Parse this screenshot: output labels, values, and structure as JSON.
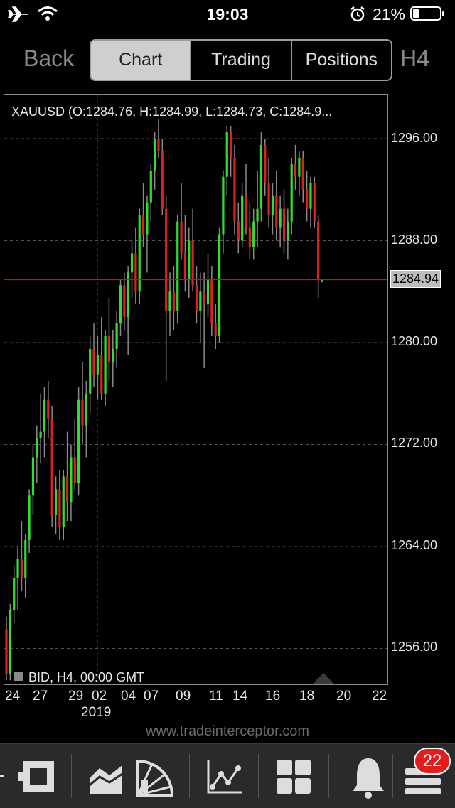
{
  "status": {
    "time": "19:03",
    "battery": "21%"
  },
  "nav": {
    "back": "Back",
    "tabs": [
      "Chart",
      "Trading",
      "Positions"
    ],
    "timeframe": "H4"
  },
  "chart": {
    "ohlc_text": "XAUUSD (O:1284.76, H:1284.99, L:1284.73, C:1284.9...",
    "bid_text": "BID, H4, 00:00 GMT",
    "current_price": "1284.94",
    "y_ticks": [
      "1296.00",
      "1288.00",
      "1280.00",
      "1272.00",
      "1264.00",
      "1256.00"
    ],
    "x_ticks": [
      "24",
      "27",
      "29",
      "02",
      "04",
      "07",
      "09",
      "11",
      "14",
      "16",
      "18",
      "20",
      "22"
    ],
    "year": "2019",
    "colors": {
      "up": "#2de02d",
      "down": "#e02020",
      "wick": "#8a8a8a",
      "price_line": "#cc1111"
    }
  },
  "chart_data": {
    "type": "candlestick",
    "symbol": "XAUUSD",
    "timeframe": "H4",
    "ylim": [
      1252,
      1298
    ],
    "current": 1284.94,
    "ohlc": [
      [
        1257.5,
        1258.5,
        1253.5,
        1254.0
      ],
      [
        1254.0,
        1259.5,
        1253.5,
        1259.0
      ],
      [
        1259.0,
        1262.5,
        1258.0,
        1261.5
      ],
      [
        1261.5,
        1264.0,
        1259.0,
        1263.0
      ],
      [
        1263.0,
        1266.0,
        1260.5,
        1261.5
      ],
      [
        1261.5,
        1265.0,
        1260.0,
        1264.5
      ],
      [
        1264.5,
        1268.5,
        1263.5,
        1268.0
      ],
      [
        1268.0,
        1272.0,
        1266.5,
        1271.0
      ],
      [
        1271.0,
        1273.5,
        1269.0,
        1272.5
      ],
      [
        1272.5,
        1276.0,
        1270.5,
        1273.0
      ],
      [
        1273.0,
        1276.5,
        1271.0,
        1275.5
      ],
      [
        1275.5,
        1277.0,
        1272.5,
        1274.0
      ],
      [
        1274.0,
        1275.0,
        1265.5,
        1266.5
      ],
      [
        1266.5,
        1269.5,
        1265.0,
        1268.5
      ],
      [
        1268.5,
        1270.0,
        1264.5,
        1265.5
      ],
      [
        1265.5,
        1270.0,
        1264.5,
        1269.5
      ],
      [
        1269.5,
        1273.0,
        1266.0,
        1267.5
      ],
      [
        1267.5,
        1272.0,
        1266.0,
        1271.0
      ],
      [
        1271.0,
        1274.0,
        1268.5,
        1269.0
      ],
      [
        1269.0,
        1276.5,
        1268.0,
        1275.5
      ],
      [
        1275.5,
        1278.5,
        1272.0,
        1273.5
      ],
      [
        1273.5,
        1277.0,
        1271.0,
        1276.0
      ],
      [
        1276.0,
        1280.5,
        1274.5,
        1279.5
      ],
      [
        1279.5,
        1281.5,
        1276.5,
        1277.5
      ],
      [
        1277.5,
        1280.5,
        1275.5,
        1279.0
      ],
      [
        1279.0,
        1282.0,
        1275.5,
        1276.0
      ],
      [
        1276.0,
        1281.0,
        1275.0,
        1280.5
      ],
      [
        1280.5,
        1283.5,
        1277.0,
        1278.5
      ],
      [
        1278.5,
        1281.0,
        1276.5,
        1279.5
      ],
      [
        1279.5,
        1282.5,
        1278.0,
        1281.5
      ],
      [
        1281.5,
        1285.0,
        1280.5,
        1284.5
      ],
      [
        1284.5,
        1285.5,
        1281.0,
        1282.0
      ],
      [
        1282.0,
        1286.0,
        1279.0,
        1285.5
      ],
      [
        1285.5,
        1288.0,
        1283.5,
        1287.0
      ],
      [
        1287.0,
        1289.0,
        1283.0,
        1284.0
      ],
      [
        1284.0,
        1290.5,
        1283.0,
        1290.0
      ],
      [
        1290.0,
        1292.5,
        1287.5,
        1288.5
      ],
      [
        1288.5,
        1291.5,
        1285.5,
        1291.0
      ],
      [
        1291.0,
        1294.0,
        1289.5,
        1293.5
      ],
      [
        1293.5,
        1296.5,
        1292.0,
        1296.0
      ],
      [
        1296.0,
        1297.5,
        1294.5,
        1295.0
      ],
      [
        1295.0,
        1296.0,
        1290.0,
        1290.5
      ],
      [
        1290.5,
        1291.5,
        1277.0,
        1282.5
      ],
      [
        1282.5,
        1285.5,
        1280.5,
        1284.0
      ],
      [
        1284.0,
        1286.0,
        1281.0,
        1282.5
      ],
      [
        1282.5,
        1290.0,
        1281.5,
        1289.5
      ],
      [
        1289.5,
        1292.5,
        1286.5,
        1287.0
      ],
      [
        1287.0,
        1290.0,
        1284.0,
        1285.0
      ],
      [
        1285.0,
        1289.0,
        1283.5,
        1288.0
      ],
      [
        1288.0,
        1290.5,
        1284.0,
        1284.5
      ],
      [
        1284.5,
        1286.0,
        1281.5,
        1282.5
      ],
      [
        1282.5,
        1285.5,
        1280.0,
        1284.0
      ],
      [
        1284.0,
        1285.5,
        1278.0,
        1283.0
      ],
      [
        1283.0,
        1287.0,
        1282.0,
        1285.0
      ],
      [
        1285.0,
        1286.0,
        1280.5,
        1281.5
      ],
      [
        1281.5,
        1283.0,
        1279.5,
        1280.5
      ],
      [
        1280.5,
        1289.0,
        1280.0,
        1288.5
      ],
      [
        1288.5,
        1293.5,
        1287.0,
        1293.0
      ],
      [
        1293.0,
        1297.0,
        1291.5,
        1296.5
      ],
      [
        1296.5,
        1297.0,
        1293.0,
        1294.5
      ],
      [
        1294.5,
        1295.5,
        1288.5,
        1289.5
      ],
      [
        1289.5,
        1291.0,
        1287.0,
        1288.0
      ],
      [
        1288.0,
        1292.5,
        1287.5,
        1291.5
      ],
      [
        1291.5,
        1294.0,
        1288.5,
        1289.0
      ],
      [
        1289.0,
        1291.0,
        1286.5,
        1287.5
      ],
      [
        1287.5,
        1290.5,
        1286.5,
        1289.5
      ],
      [
        1289.5,
        1293.5,
        1287.5,
        1290.5
      ],
      [
        1290.5,
        1296.5,
        1289.5,
        1295.5
      ],
      [
        1295.5,
        1296.0,
        1291.5,
        1292.5
      ],
      [
        1292.5,
        1294.5,
        1289.0,
        1290.0
      ],
      [
        1290.0,
        1292.5,
        1288.5,
        1291.5
      ],
      [
        1291.5,
        1293.5,
        1288.0,
        1289.0
      ],
      [
        1289.0,
        1291.5,
        1287.5,
        1290.5
      ],
      [
        1290.5,
        1292.0,
        1287.0,
        1288.0
      ],
      [
        1288.0,
        1290.5,
        1286.5,
        1289.5
      ],
      [
        1289.5,
        1294.5,
        1288.5,
        1294.0
      ],
      [
        1294.0,
        1295.5,
        1292.0,
        1293.0
      ],
      [
        1293.0,
        1295.0,
        1291.5,
        1294.5
      ],
      [
        1294.5,
        1295.0,
        1291.0,
        1292.0
      ],
      [
        1292.0,
        1293.5,
        1289.5,
        1290.5
      ],
      [
        1290.5,
        1293.0,
        1289.0,
        1292.5
      ],
      [
        1292.5,
        1293.0,
        1289.0,
        1289.5
      ],
      [
        1289.5,
        1290.0,
        1283.5,
        1285.0
      ],
      [
        1284.76,
        1284.99,
        1284.73,
        1284.94
      ]
    ]
  },
  "footer": {
    "watermark": "www.tradeinterceptor.com",
    "badge": "22"
  }
}
